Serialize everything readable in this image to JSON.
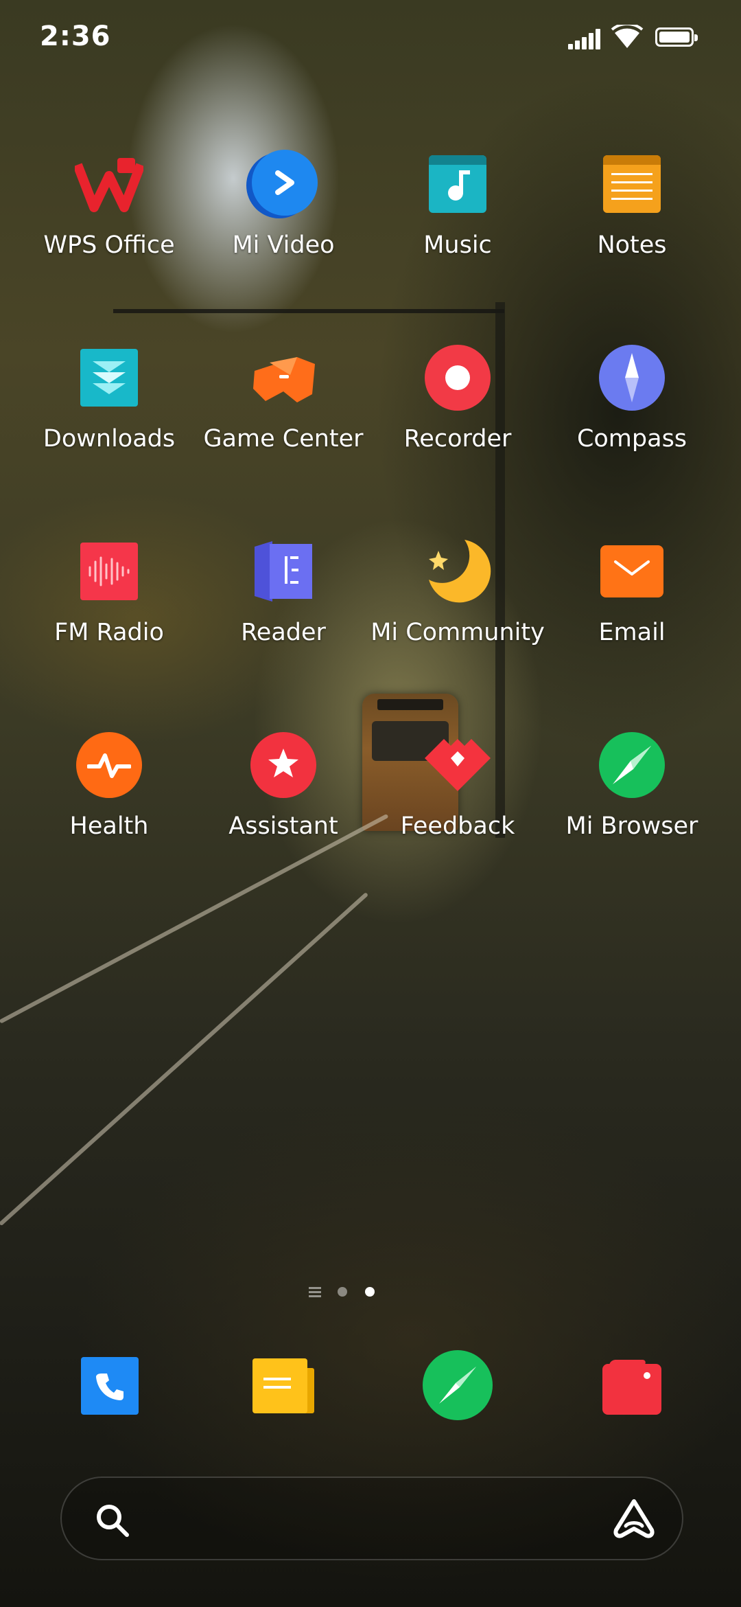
{
  "status_bar": {
    "time": "2:36",
    "icons": [
      "signal-icon",
      "wifi-icon",
      "battery-icon"
    ]
  },
  "apps": [
    {
      "label": "WPS Office",
      "icon": "wps-office-icon",
      "color": "#E8232D"
    },
    {
      "label": "Mi Video",
      "icon": "mi-video-icon",
      "color": "#1E88F0"
    },
    {
      "label": "Music",
      "icon": "music-icon",
      "color": "#1BB5C4"
    },
    {
      "label": "Notes",
      "icon": "notes-icon",
      "color": "#F5A11C"
    },
    {
      "label": "Downloads",
      "icon": "downloads-icon",
      "color": "#18B8C9"
    },
    {
      "label": "Game Center",
      "icon": "game-center-icon",
      "color": "#FF6D1A"
    },
    {
      "label": "Recorder",
      "icon": "recorder-icon",
      "color": "#F23A46"
    },
    {
      "label": "Compass",
      "icon": "compass-icon",
      "color": "#6B7BF0"
    },
    {
      "label": "FM Radio",
      "icon": "fm-radio-icon",
      "color": "#F5364A"
    },
    {
      "label": "Reader",
      "icon": "reader-icon",
      "color": "#6B6FF2"
    },
    {
      "label": "Mi Community",
      "icon": "mi-community-icon",
      "color": "#FBB829"
    },
    {
      "label": "Email",
      "icon": "email-icon",
      "color": "#FF7316"
    },
    {
      "label": "Health",
      "icon": "health-icon",
      "color": "#FF6A14"
    },
    {
      "label": "Assistant",
      "icon": "assistant-app-icon",
      "color": "#F2323F"
    },
    {
      "label": "Feedback",
      "icon": "feedback-icon",
      "color": "#F4333E"
    },
    {
      "label": "Mi Browser",
      "icon": "mi-browser-icon",
      "color": "#17C05B"
    }
  ],
  "page_indicator": {
    "pages": 2,
    "current": 2
  },
  "dock": [
    {
      "icon": "phone-icon",
      "color": "#1E8AF5"
    },
    {
      "icon": "messages-icon",
      "color": "#FFC21A"
    },
    {
      "icon": "browser-icon",
      "color": "#17C05B"
    },
    {
      "icon": "security-icon",
      "color": "#F2323F"
    }
  ],
  "search_bar": {
    "icons": [
      "search-icon",
      "assistant-icon"
    ]
  }
}
